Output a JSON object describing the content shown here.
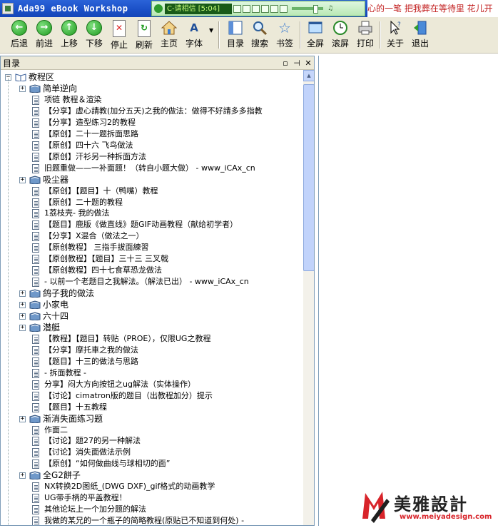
{
  "window": {
    "title": "Ada99 eBook Workshop"
  },
  "player": {
    "track": "C-请相信 [5:04]",
    "marquee": "心的一笔   把我葬在等待里   花儿开"
  },
  "toolbar": {
    "back": "后退",
    "forward": "前进",
    "up": "上移",
    "down": "下移",
    "stop": "停止",
    "refresh": "刷新",
    "home": "主页",
    "font": "字体",
    "toc": "目录",
    "search": "搜索",
    "bookmark": "书签",
    "fullscreen": "全屏",
    "scroll": "滚屏",
    "print": "打印",
    "about": "关于",
    "exit": "退出"
  },
  "pane": {
    "title": "目录"
  },
  "tree": {
    "root": "教程区",
    "items": [
      {
        "type": "folder",
        "label": "简单逆向"
      },
      {
        "type": "page",
        "label": "项链   教程＆渲染"
      },
      {
        "type": "page",
        "label": "【分享】虚心請教(加分五天)之我的做法：做得不好請多多指教"
      },
      {
        "type": "page",
        "label": "【分享】造型练习2的教程"
      },
      {
        "type": "page",
        "label": "【原创】二十一题拆面思路"
      },
      {
        "type": "page",
        "label": "【原创】四十六   飞鸟做法"
      },
      {
        "type": "page",
        "label": "【原创】汗衫另一种拆面方法"
      },
      {
        "type": "page",
        "label": "旧题重做——一补面题！（转自小题大做） - www_iCAx_cn"
      },
      {
        "type": "folder",
        "label": "吸尘器"
      },
      {
        "type": "page",
        "label": "【原创】【题目】十（鸭嘴）教程"
      },
      {
        "type": "page",
        "label": "【原创】二十题的教程"
      },
      {
        "type": "page",
        "label": "1荔枝壳- 我的做法"
      },
      {
        "type": "page",
        "label": "【题目】鹿版《做直线》题GIF动画教程（献给初学者）"
      },
      {
        "type": "page",
        "label": "【分享】X混合（做法之一）"
      },
      {
        "type": "page",
        "label": "【原创教程】 三指手拔面練習"
      },
      {
        "type": "page",
        "label": "【原创教程】【题目】三十三 三叉戟"
      },
      {
        "type": "page",
        "label": "【原创教程】四十七食草恐龙做法"
      },
      {
        "type": "page",
        "label": "- 以前一个老题目之我解法。（解法已出） - www_iCAx_cn"
      },
      {
        "type": "folder",
        "label": "鸽子我的做法"
      },
      {
        "type": "folder",
        "label": "小家电"
      },
      {
        "type": "folder",
        "label": "六十四"
      },
      {
        "type": "folder",
        "label": "潜艇"
      },
      {
        "type": "page",
        "label": "【教程】【题目】转贴（PROE），仅限UG之教程"
      },
      {
        "type": "page",
        "label": "【分享】摩托車之我的做法"
      },
      {
        "type": "page",
        "label": "【题目】十三的做法与思路"
      },
      {
        "type": "page",
        "label": "- 拆面教程 -"
      },
      {
        "type": "page",
        "label": "分享】闷大方向按钮之ug解法（实体操作）"
      },
      {
        "type": "page",
        "label": "【讨论】cimatron版的题目（出教程加分）提示"
      },
      {
        "type": "page",
        "label": "【题目】十五教程"
      },
      {
        "type": "folder",
        "label": "渐消失面练习题"
      },
      {
        "type": "page",
        "label": "作面二"
      },
      {
        "type": "page",
        "label": "【讨论】题27的另一种解法"
      },
      {
        "type": "page",
        "label": "【讨论】消失面做法示例"
      },
      {
        "type": "page",
        "label": "【原创】“如何做曲线与球相切的面”"
      },
      {
        "type": "folder",
        "label": "全G2餅子"
      },
      {
        "type": "page",
        "label": "NX转换2D图纸_(DWG DXF)_gif格式的动画教学"
      },
      {
        "type": "page",
        "label": "UG带手柄的平盖教程！"
      },
      {
        "type": "page",
        "label": "其他论坛上一个加分题的解法"
      },
      {
        "type": "page",
        "label": "我做的某兄的一个瓶子的简略教程(原贴已不知道到何处) -"
      }
    ]
  },
  "watermark": {
    "brand": "美雅設計",
    "url": "www.meiyadesign.com"
  }
}
